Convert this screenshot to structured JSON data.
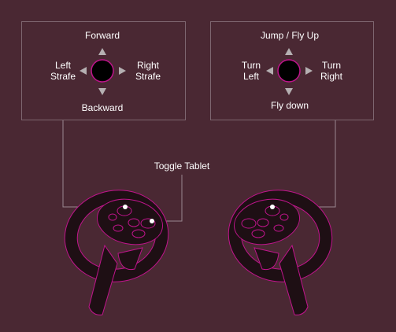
{
  "left_panel": {
    "forward": "Forward",
    "backward": "Backward",
    "left": "Left\nStrafe",
    "right": "Right\nStrafe"
  },
  "right_panel": {
    "up": "Jump / Fly Up",
    "down": "Fly down",
    "left": "Turn\nLeft",
    "right": "Turn\nRight"
  },
  "toggle_label": "Toggle Tablet",
  "colors": {
    "background": "#4a2833",
    "controller_outline": "#c0148c",
    "controller_fill": "#1e0f14",
    "connector": "#9a8890",
    "marker": "#ffffff"
  }
}
